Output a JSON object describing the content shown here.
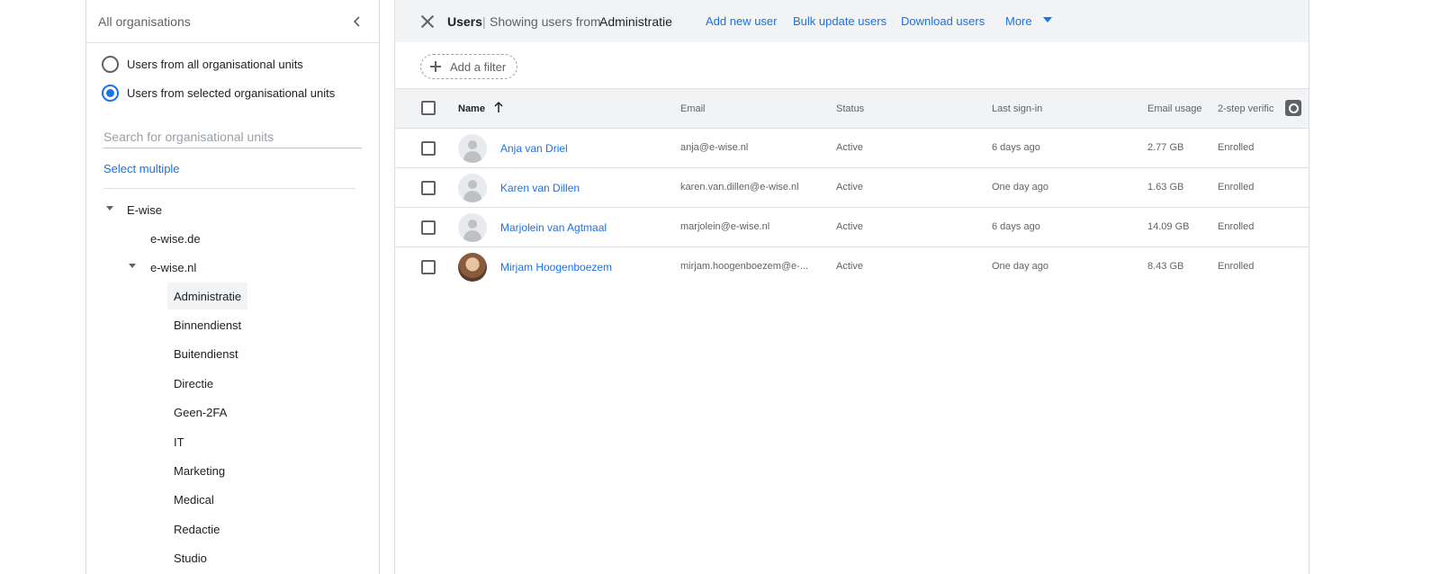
{
  "org_panel": {
    "title": "All organisations",
    "radio_all": "Users from all organisational units",
    "radio_selected": "Users from selected organisational units",
    "search_placeholder": "Search for organisational units",
    "select_multiple": "Select multiple",
    "tree": {
      "root": "E-wise",
      "child_de": "e-wise.de",
      "child_nl": "e-wise.nl",
      "units": [
        "Administratie",
        "Binnendienst",
        "Buitendienst",
        "Directie",
        "Geen-2FA",
        "IT",
        "Marketing",
        "Medical",
        "Redactie",
        "Studio"
      ]
    }
  },
  "topbar": {
    "title": "Users",
    "separator": "|",
    "subtitle": "Showing users from",
    "current_unit": "Administratie",
    "add_user": "Add new user",
    "bulk_update": "Bulk update users",
    "download": "Download users",
    "more": "More"
  },
  "filter": {
    "add_filter": "Add a filter"
  },
  "table": {
    "columns": {
      "name": "Name",
      "email": "Email",
      "status": "Status",
      "last_signin": "Last sign-in",
      "email_usage": "Email usage",
      "two_step": "2-step verific"
    },
    "rows": [
      {
        "name": "Anja van Driel",
        "email": "anja@e-wise.nl",
        "status": "Active",
        "last_signin": "6 days ago",
        "usage": "2.77 GB",
        "two_step": "Enrolled"
      },
      {
        "name": "Karen van Dillen",
        "email": "karen.van.dillen@e-wise.nl",
        "status": "Active",
        "last_signin": "One day ago",
        "usage": "1.63 GB",
        "two_step": "Enrolled"
      },
      {
        "name": "Marjolein van Agtmaal",
        "email": "marjolein@e-wise.nl",
        "status": "Active",
        "last_signin": "6 days ago",
        "usage": "14.09 GB",
        "two_step": "Enrolled"
      },
      {
        "name": "Mirjam Hoogenboezem",
        "email": "mirjam.hoogenboezem@e-...",
        "status": "Active",
        "last_signin": "One day ago",
        "usage": "8.43 GB",
        "two_step": "Enrolled"
      }
    ]
  },
  "colors": {
    "accent": "#1a73e8",
    "header_bg": "#f1f3f4"
  }
}
